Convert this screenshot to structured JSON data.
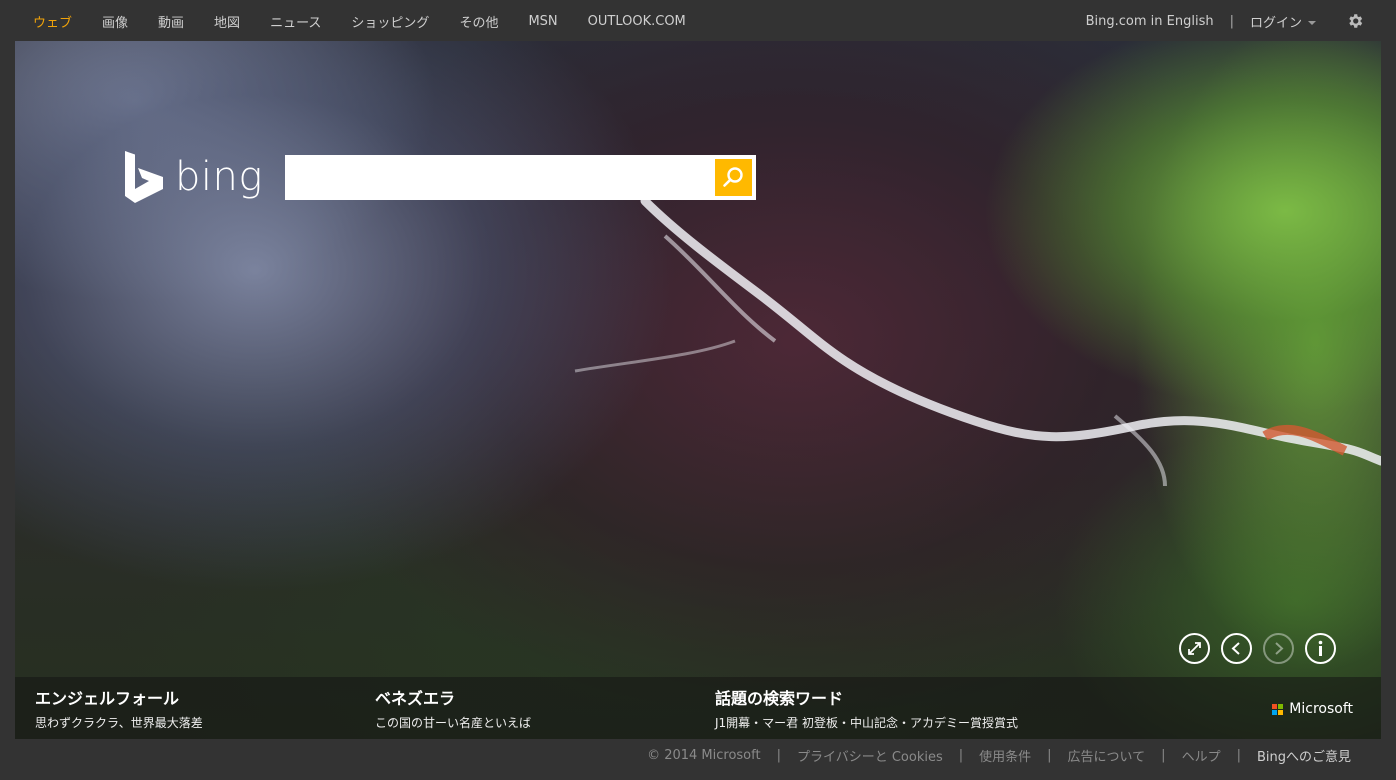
{
  "nav": {
    "items": [
      {
        "label": "ウェブ",
        "active": true
      },
      {
        "label": "画像",
        "active": false
      },
      {
        "label": "動画",
        "active": false
      },
      {
        "label": "地図",
        "active": false
      },
      {
        "label": "ニュース",
        "active": false
      },
      {
        "label": "ショッピング",
        "active": false
      },
      {
        "label": "その他",
        "active": false
      },
      {
        "label": "MSN",
        "active": false
      },
      {
        "label": "OUTLOOK.COM",
        "active": false
      }
    ],
    "english_link": "Bing.com in English",
    "separator": "|",
    "login": "ログイン",
    "settings_icon": "gear-icon"
  },
  "search": {
    "logo_text": "bing",
    "value": "",
    "placeholder": "",
    "button_icon": "search-icon"
  },
  "hero_controls": [
    {
      "icon": "expand-icon"
    },
    {
      "icon": "chevron-left-icon"
    },
    {
      "icon": "chevron-right-icon",
      "disabled": true
    },
    {
      "icon": "info-icon"
    }
  ],
  "captions": [
    {
      "title": "エンジェルフォール",
      "subtitle": "思わずクラクラ、世界最大落差"
    },
    {
      "title": "ベネズエラ",
      "subtitle": "この国の甘ーい名産といえば"
    },
    {
      "title": "話題の検索ワード",
      "subtitle": "J1開幕・マー君 初登板・中山記念・アカデミー賞授賞式"
    }
  ],
  "microsoft_logo": {
    "text": "Microsoft",
    "colors": [
      "#f25022",
      "#7fba00",
      "#00a4ef",
      "#ffb900"
    ]
  },
  "footer": {
    "links": [
      {
        "label": "© 2014 Microsoft"
      },
      {
        "label": "プライバシーと Cookies"
      },
      {
        "label": "使用条件"
      },
      {
        "label": "広告について"
      },
      {
        "label": "ヘルプ"
      },
      {
        "label": "Bingへのご意見"
      }
    ],
    "separator": "|"
  },
  "colors": {
    "accent": "#f0a30a",
    "search_button": "#ffb900",
    "page_bg": "#333333"
  }
}
